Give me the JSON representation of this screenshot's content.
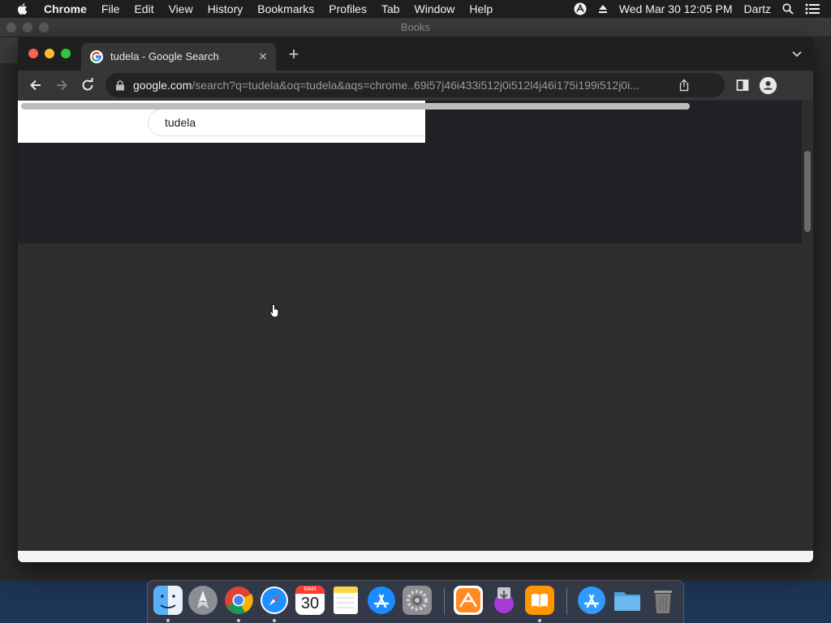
{
  "menubar": {
    "app": "Chrome",
    "items": [
      "File",
      "Edit",
      "View",
      "History",
      "Bookmarks",
      "Profiles",
      "Tab",
      "Window",
      "Help"
    ],
    "datetime": "Wed Mar 30  12:05 PM",
    "user": "Dartz",
    "icons": [
      "apple-icon",
      "accessibility-icon",
      "eject-icon",
      "spotlight-icon",
      "control-center-icon"
    ]
  },
  "background_window": {
    "title": "Books"
  },
  "browser": {
    "tab": {
      "title": "tudela - Google Search",
      "favicon": "google-icon"
    },
    "url": {
      "host": "google.com",
      "path": "/search?q=tudela&oq=tudela&aqs=chrome..69i57j46i433i512j0i512l4j46i175i199i512j0i..."
    }
  },
  "page": {
    "search_query": "tudela"
  },
  "dock": {
    "apps": [
      "finder",
      "launchpad",
      "chrome",
      "safari",
      "calendar",
      "notes",
      "app-store",
      "system-preferences",
      "instastats",
      "installer",
      "books",
      "downloads-folder",
      "folder",
      "trash"
    ],
    "calendar": {
      "month": "MAR",
      "day": "30"
    }
  },
  "colors": {
    "accent": "#1a73e8",
    "page_bg": "#2e2e2e"
  }
}
